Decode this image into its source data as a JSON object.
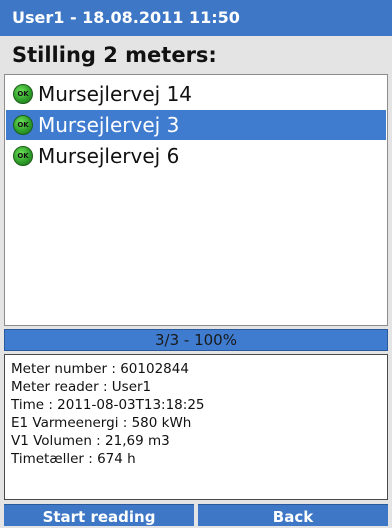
{
  "header": {
    "title": "User1 - 18.08.2011 11:50"
  },
  "subtitle": "Stilling 2 meters:",
  "meters": [
    {
      "name": "Mursejlervej 14",
      "status": "OK",
      "selected": false
    },
    {
      "name": "Mursejlervej 3",
      "status": "OK",
      "selected": true
    },
    {
      "name": "Mursejlervej 6",
      "status": "OK",
      "selected": false
    }
  ],
  "progress": {
    "label": "3/3 - 100%",
    "fraction": 1.0
  },
  "details": [
    "Meter number : 60102844",
    "Meter reader : User1",
    "Time : 2011-08-03T13:18:25",
    "E1 Varmeenergi : 580 kWh",
    "V1 Volumen : 21,69 m3",
    "Timetæller : 674 h"
  ],
  "buttons": {
    "start": "Start reading",
    "back": "Back"
  },
  "colors": {
    "accent": "#3e77c6",
    "selected": "#3f7cd0",
    "ok_icon": "#2fa02a"
  }
}
